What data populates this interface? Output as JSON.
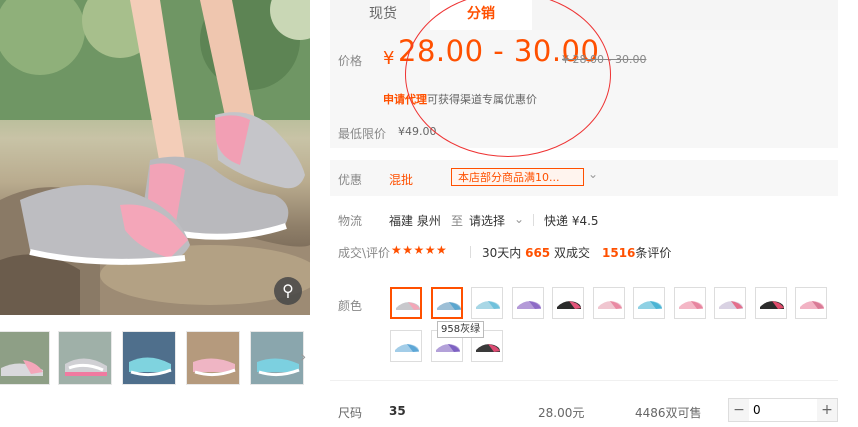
{
  "gallery": {
    "zoom_icon": "magnifier-icon",
    "thumbnails": [
      "thumb-1",
      "thumb-2",
      "thumb-3",
      "thumb-4",
      "thumb-5"
    ],
    "next_icon": "chevron-right-icon"
  },
  "tabs": [
    {
      "label": "现货",
      "active": false
    },
    {
      "label": "分销",
      "active": true
    }
  ],
  "price": {
    "label": "价格",
    "currency": "¥",
    "range": "28.00 - 30.00",
    "original": "¥ 28.00 - 30.00",
    "agent_link": "申请代理",
    "agent_text": "可获得渠道专属优惠价",
    "min_label": "最低限价",
    "min_value": "¥49.00"
  },
  "promo": {
    "label": "优惠",
    "mixed": "混批",
    "coupon": "本店部分商品满10...",
    "more_icon": "chevron-down-icon"
  },
  "shipping": {
    "label": "物流",
    "from": "福建 泉州",
    "to_word": "至",
    "select": "请选择",
    "express": "快递 ¥4.5"
  },
  "deals": {
    "label": "成交\\评价",
    "stars": "★★★★★",
    "period": "30天内",
    "count": "665",
    "unit": "双成交",
    "reviews": "1516",
    "reviews_unit": "条评价"
  },
  "color": {
    "label": "颜色",
    "swatches": [
      {
        "name": "swatch-1",
        "shoe": "#c8c8cc",
        "accent": "#f3a7b8",
        "selected": true
      },
      {
        "name": "swatch-2",
        "shoe": "#9dbfd6",
        "accent": "#5aa6cf",
        "selected": true
      },
      {
        "name": "swatch-3",
        "shoe": "#a8d7e6",
        "accent": "#6fc1dc",
        "selected": false
      },
      {
        "name": "swatch-4",
        "shoe": "#b49ad8",
        "accent": "#8d6bc6",
        "selected": false
      },
      {
        "name": "swatch-5",
        "shoe": "#2b2b2b",
        "accent": "#e2557a",
        "selected": false
      },
      {
        "name": "swatch-6",
        "shoe": "#f0c6d0",
        "accent": "#e98aa3",
        "selected": false
      },
      {
        "name": "swatch-7",
        "shoe": "#8fd1e4",
        "accent": "#4bb4d4",
        "selected": false
      },
      {
        "name": "swatch-8",
        "shoe": "#f4b7c6",
        "accent": "#e7859f",
        "selected": false
      },
      {
        "name": "swatch-9",
        "shoe": "#d9d2e3",
        "accent": "#e46f8c",
        "selected": false
      },
      {
        "name": "swatch-10",
        "shoe": "#2d2d2d",
        "accent": "#e24c6c",
        "selected": false
      },
      {
        "name": "swatch-11",
        "shoe": "#f2b3c4",
        "accent": "#d97b96",
        "selected": false
      },
      {
        "name": "swatch-12",
        "shoe": "#a3cde8",
        "accent": "#5ea7d6",
        "selected": false
      },
      {
        "name": "swatch-13",
        "shoe": "#b3a1d9",
        "accent": "#7d61c2",
        "selected": false
      },
      {
        "name": "swatch-14",
        "shoe": "#3a3a3a",
        "accent": "#dc4a72",
        "selected": false
      }
    ],
    "tooltip": "958灰绿"
  },
  "size": {
    "label": "尺码",
    "value": "35",
    "price": "28.00元",
    "stock": "4486双可售",
    "minus": "−",
    "qty": "0",
    "plus": "+"
  },
  "accent": "#ff5000"
}
